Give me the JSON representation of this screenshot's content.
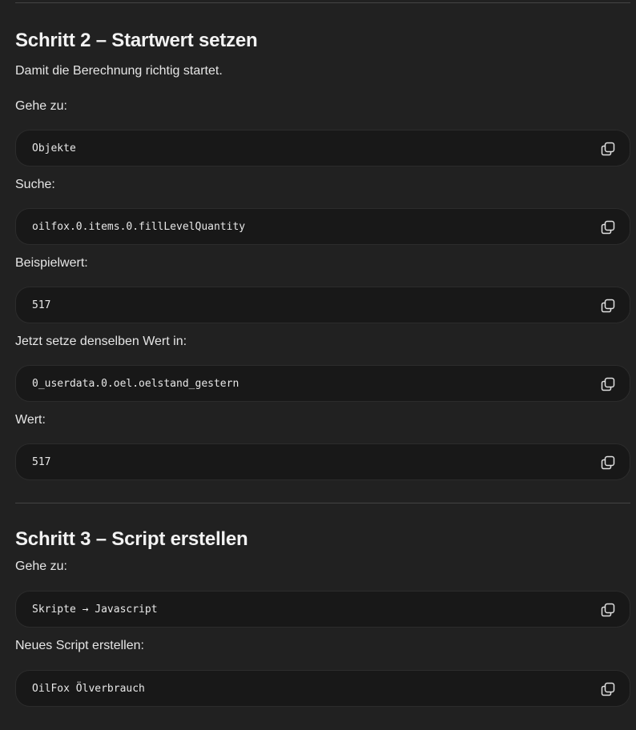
{
  "step2": {
    "heading": "Schritt 2 – Startwert setzen",
    "intro": "Damit die Berechnung richtig startet.",
    "label_goto": "Gehe zu:",
    "code_goto": "Objekte",
    "label_search": "Suche:",
    "code_search": "oilfox.0.items.0.fillLevelQuantity",
    "label_example": "Beispielwert:",
    "code_example": "517",
    "label_set": "Jetzt setze denselben Wert in:",
    "code_set": "0_userdata.0.oel.oelstand_gestern",
    "label_value": "Wert:",
    "code_value": "517"
  },
  "step3": {
    "heading": "Schritt 3 – Script erstellen",
    "label_goto": "Gehe zu:",
    "code_goto": "Skripte → Javascript",
    "label_new": "Neues Script erstellen:",
    "code_new": "OilFox Ölverbrauch"
  },
  "icons": {
    "copy": "copy-icon"
  }
}
